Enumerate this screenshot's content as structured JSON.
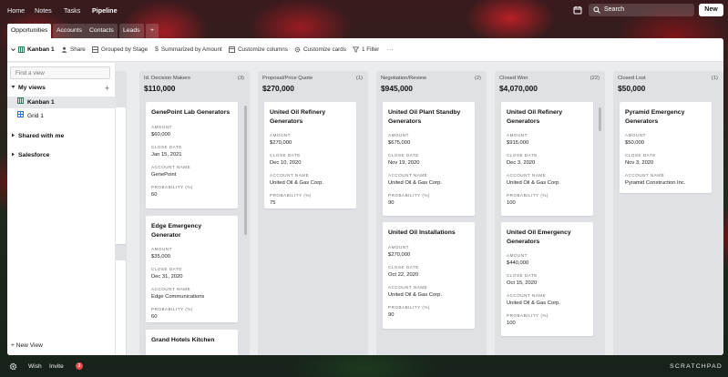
{
  "topnav": {
    "links": [
      "Home",
      "Notes",
      "Tasks",
      "Pipeline"
    ],
    "active": "Pipeline",
    "search_label": "Search",
    "new_label": "New"
  },
  "tabs": [
    "Opportunities",
    "Accounts",
    "Contacts",
    "Leads",
    "+"
  ],
  "toolbar": {
    "view_name": "Kanban 1",
    "share": "Share",
    "grouped": "Grouped by Stage",
    "summarized": "Summarized by Amount",
    "customize_columns": "Customize columns",
    "customize_cards": "Customize cards",
    "filter": "1 Filter",
    "more": "···"
  },
  "sidebar": {
    "find_placeholder": "Find a view",
    "my_views": "My views",
    "views": [
      {
        "label": "Kanban 1",
        "icon": "kanban-icon"
      },
      {
        "label": "Grid 1",
        "icon": "grid-icon"
      }
    ],
    "shared": "Shared with me",
    "salesforce": "Salesforce",
    "new_view": "+ New View"
  },
  "field_labels": {
    "amount": "AMOUNT",
    "close_date": "CLOSE DATE",
    "account_name": "ACCOUNT NAME",
    "probability": "PROBABILITY (%)"
  },
  "columns": [
    {
      "name": "Id. Decision Makers",
      "count": "(3)",
      "amount": "$110,000",
      "cards": [
        {
          "title": "GenePoint Lab Generators",
          "amount": "$60,000",
          "close_date": "Jan 15, 2021",
          "account": "GenePoint",
          "probability": "60"
        },
        {
          "title": "Edge Emergency Generator",
          "amount": "$35,000",
          "close_date": "Dec 31, 2020",
          "account": "Edge Communications",
          "probability": "60"
        },
        {
          "title": "Grand Hotels Kitchen"
        }
      ]
    },
    {
      "name": "Proposal/Price Quote",
      "count": "(1)",
      "amount": "$270,000",
      "cards": [
        {
          "title": "United Oil Refinery Generators",
          "amount": "$270,000",
          "close_date": "Dec 10, 2020",
          "account": "United Oil & Gas Corp.",
          "probability": "75"
        }
      ]
    },
    {
      "name": "Negotiation/Review",
      "count": "(2)",
      "amount": "$945,000",
      "cards": [
        {
          "title": "United Oil Plant Standby Generators",
          "amount": "$675,000",
          "close_date": "Nov 19, 2020",
          "account": "United Oil & Gas Corp.",
          "probability": "90"
        },
        {
          "title": "United Oil Installations",
          "amount": "$270,000",
          "close_date": "Oct 22, 2020",
          "account": "United Oil & Gas Corp.",
          "probability": "90"
        }
      ]
    },
    {
      "name": "Closed Won",
      "count": "(22)",
      "amount": "$4,070,000",
      "cards": [
        {
          "title": "United Oil Refinery Generators",
          "amount": "$915,000",
          "close_date": "Dec 3, 2020",
          "account": "United Oil & Gas Corp.",
          "probability": "100"
        },
        {
          "title": "United Oil Emergency Generators",
          "amount": "$440,000",
          "close_date": "Oct 15, 2020",
          "account": "United Oil & Gas Corp.",
          "probability": "100"
        }
      ]
    },
    {
      "name": "Closed Lost",
      "count": "(1)",
      "amount": "$50,000",
      "cards": [
        {
          "title": "Pyramid Emergency Generators",
          "amount": "$50,000",
          "close_date": "Nov 3, 2020",
          "account": "Pyramid Construction Inc."
        }
      ]
    }
  ],
  "bottombar": {
    "wish": "Wish",
    "invite": "Invite",
    "badge": "3",
    "brand": "SCRATCHPAD"
  },
  "colors": {
    "panel_bg": "#ebecee",
    "column_bg": "#dfe1e5",
    "badge_red": "#e5484d",
    "active_view_bg": "#e4e6ea"
  }
}
